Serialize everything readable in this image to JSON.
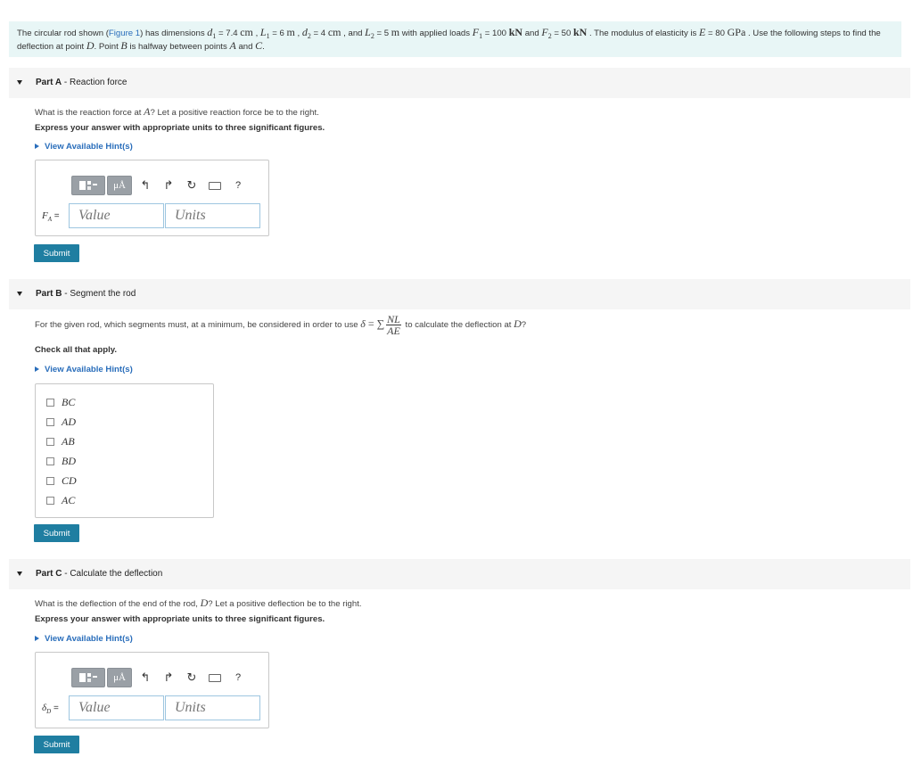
{
  "intro": {
    "p1": "The circular rod shown (",
    "figure_link": "Figure 1",
    "p2": ") has dimensions ",
    "d1_sym": "d",
    "d1_sub": "1",
    "d1_val": " = 7.4 ",
    "unit_cm": "cm",
    "sep": " , ",
    "L1_sym": "L",
    "L1_sub": "1",
    "L1_val": " = 6 ",
    "unit_m": "m",
    "d2_sym": "d",
    "d2_sub": "2",
    "d2_val": " = 4 ",
    "and1": " , and ",
    "L2_sym": "L",
    "L2_sub": "2",
    "L2_val": " = 5 ",
    "p3": " with applied loads ",
    "F1_sym": "F",
    "F1_sub": "1",
    "F1_val": " = 100 ",
    "unit_kN": "kN",
    "and2": " and ",
    "F2_sym": "F",
    "F2_sub": "2",
    "F2_val": " = 50 ",
    "p4": " . The modulus of elasticity is ",
    "E_sym": "E",
    "E_val": " = 80 ",
    "unit_GPa": "GPa",
    "p5": " . Use the following steps to find the",
    "line2a": "deflection at point ",
    "pt_D": "D",
    "line2b": ". Point ",
    "pt_B": "B",
    "line2c": " is halfway between points ",
    "pt_A": "A",
    "line2d": " and ",
    "pt_C": "C",
    "line2e": "."
  },
  "parts": {
    "a": {
      "label": "Part A",
      "title": " - Reaction force",
      "q1": "What is the reaction force at ",
      "q_sym": "A",
      "q2": "? Let a positive reaction force be to the right.",
      "instr": "Express your answer with appropriate units to three significant figures.",
      "hint": "View Available Hint(s)",
      "var_sym": "F",
      "var_sub": "A",
      "eq": " =",
      "value_placeholder": "Value",
      "units_placeholder": "Units",
      "submit": "Submit"
    },
    "b": {
      "label": "Part B",
      "title": " - Segment the rod",
      "q1": "For the given rod, which segments must, at a minimum, be considered in order to use ",
      "delta": "δ",
      "eq_sum": " = ∑",
      "frac_num": "NL",
      "frac_den": "AE",
      "q2": " to calculate the deflection at ",
      "q_sym": "D",
      "q3": "?",
      "instr": "Check all that apply.",
      "hint": "View Available Hint(s)",
      "options": [
        "BC",
        "AD",
        "AB",
        "BD",
        "CD",
        "AC"
      ],
      "submit": "Submit"
    },
    "c": {
      "label": "Part C",
      "title": " - Calculate the deflection",
      "q1": "What is the deflection of the end of the rod, ",
      "q_sym": "D",
      "q2": "? Let a positive deflection be to the right.",
      "instr": "Express your answer with appropriate units to three significant figures.",
      "hint": "View Available Hint(s)",
      "var_sym": "δ",
      "var_sub": "D",
      "eq": " =",
      "value_placeholder": "Value",
      "units_placeholder": "Units",
      "submit": "Submit"
    }
  },
  "toolbar": {
    "mu_label": "μÅ",
    "undo": "↰",
    "redo": "↱",
    "reset": "↻",
    "help": "?"
  },
  "icons": [
    "templates-icon",
    "symbols-icon",
    "undo-icon",
    "redo-icon",
    "reset-icon",
    "keyboard-icon",
    "help-icon"
  ],
  "colors": {
    "accent": "#1f7ea1",
    "link": "#2a6ebb",
    "intro_bg": "#e8f6f6",
    "header_bg": "#f5f5f5"
  }
}
